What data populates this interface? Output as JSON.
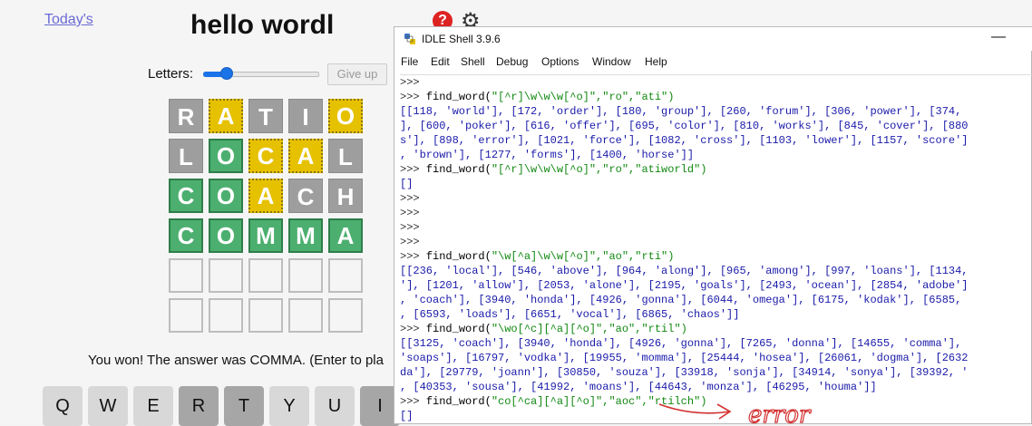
{
  "wordle": {
    "todays_link": "Today's",
    "title": "hello wordl",
    "help_icon_glyph": "?",
    "gear_icon_glyph": "⚙",
    "letters_label": "Letters:",
    "letters_slider_value": 0.17,
    "giveup_label": "Give up",
    "rows": [
      [
        {
          "letter": "R",
          "state": "absent"
        },
        {
          "letter": "A",
          "state": "present"
        },
        {
          "letter": "T",
          "state": "absent"
        },
        {
          "letter": "I",
          "state": "absent"
        },
        {
          "letter": "O",
          "state": "present"
        }
      ],
      [
        {
          "letter": "L",
          "state": "absent"
        },
        {
          "letter": "O",
          "state": "correct"
        },
        {
          "letter": "C",
          "state": "present"
        },
        {
          "letter": "A",
          "state": "present"
        },
        {
          "letter": "L",
          "state": "absent"
        }
      ],
      [
        {
          "letter": "C",
          "state": "correct"
        },
        {
          "letter": "O",
          "state": "correct"
        },
        {
          "letter": "A",
          "state": "present"
        },
        {
          "letter": "C",
          "state": "absent"
        },
        {
          "letter": "H",
          "state": "absent"
        }
      ],
      [
        {
          "letter": "C",
          "state": "correct"
        },
        {
          "letter": "O",
          "state": "correct"
        },
        {
          "letter": "M",
          "state": "correct"
        },
        {
          "letter": "M",
          "state": "correct"
        },
        {
          "letter": "A",
          "state": "correct"
        }
      ],
      [
        {
          "letter": "",
          "state": "empty"
        },
        {
          "letter": "",
          "state": "empty"
        },
        {
          "letter": "",
          "state": "empty"
        },
        {
          "letter": "",
          "state": "empty"
        },
        {
          "letter": "",
          "state": "empty"
        }
      ],
      [
        {
          "letter": "",
          "state": "empty"
        },
        {
          "letter": "",
          "state": "empty"
        },
        {
          "letter": "",
          "state": "empty"
        },
        {
          "letter": "",
          "state": "empty"
        },
        {
          "letter": "",
          "state": "empty"
        }
      ]
    ],
    "message": "You won! The answer was COMMA. (Enter to pla",
    "keys": [
      {
        "label": "Q",
        "state": "plain"
      },
      {
        "label": "W",
        "state": "plain"
      },
      {
        "label": "E",
        "state": "plain"
      },
      {
        "label": "R",
        "state": "absent"
      },
      {
        "label": "T",
        "state": "absent"
      },
      {
        "label": "Y",
        "state": "plain"
      },
      {
        "label": "U",
        "state": "plain"
      },
      {
        "label": "I",
        "state": "absent"
      }
    ]
  },
  "idle": {
    "window_title": "IDLE Shell 3.9.6",
    "minimize_glyph": "—",
    "menu": [
      "File",
      "Edit",
      "Shell",
      "Debug",
      "Options",
      "Window",
      "Help"
    ],
    "lines": [
      {
        "kind": "prompt",
        "prompt": ">>>",
        "cmd": "",
        "args": ""
      },
      {
        "kind": "input",
        "prompt": ">>>",
        "cmd": "find_word(",
        "args": "\"[^r]\\w\\w\\w[^o]\",\"ro\",\"ati\")"
      },
      {
        "kind": "output",
        "text": "[[118, 'world'], [172, 'order'], [180, 'group'], [260, 'forum'], [306, 'power'], [374,"
      },
      {
        "kind": "output",
        "text": "], [600, 'poker'], [616, 'offer'], [695, 'color'], [810, 'works'], [845, 'cover'], [880"
      },
      {
        "kind": "output",
        "text": "s'], [898, 'error'], [1021, 'force'], [1082, 'cross'], [1103, 'lower'], [1157, 'score']"
      },
      {
        "kind": "output",
        "text": ", 'brown'], [1277, 'forms'], [1400, 'horse']]"
      },
      {
        "kind": "input",
        "prompt": ">>>",
        "cmd": "find_word(",
        "args": "\"[^r]\\w\\w\\w[^o]\",\"ro\",\"atiworld\")"
      },
      {
        "kind": "output",
        "text": "[]"
      },
      {
        "kind": "prompt",
        "prompt": ">>>",
        "cmd": "",
        "args": ""
      },
      {
        "kind": "prompt",
        "prompt": ">>>",
        "cmd": "",
        "args": ""
      },
      {
        "kind": "prompt",
        "prompt": ">>>",
        "cmd": "",
        "args": ""
      },
      {
        "kind": "prompt",
        "prompt": ">>>",
        "cmd": "",
        "args": ""
      },
      {
        "kind": "input",
        "prompt": ">>>",
        "cmd": "find_word(",
        "args": "\"\\w[^a]\\w\\w[^o]\",\"ao\",\"rti\")"
      },
      {
        "kind": "output",
        "text": "[[236, 'local'], [546, 'above'], [964, 'along'], [965, 'among'], [997, 'loans'], [1134,"
      },
      {
        "kind": "output",
        "text": "'], [1201, 'allow'], [2053, 'alone'], [2195, 'goals'], [2493, 'ocean'], [2854, 'adobe']"
      },
      {
        "kind": "output",
        "text": ", 'coach'], [3940, 'honda'], [4926, 'gonna'], [6044, 'omega'], [6175, 'kodak'], [6585,"
      },
      {
        "kind": "output",
        "text": ", [6593, 'loads'], [6651, 'vocal'], [6865, 'chaos']]"
      },
      {
        "kind": "input",
        "prompt": ">>>",
        "cmd": "find_word(",
        "args": "\"\\wo[^c][^a][^o]\",\"ao\",\"rtil\")"
      },
      {
        "kind": "output",
        "text": "[[3125, 'coach'], [3940, 'honda'], [4926, 'gonna'], [7265, 'donna'], [14655, 'comma'],"
      },
      {
        "kind": "output",
        "text": "'soaps'], [16797, 'vodka'], [19955, 'momma'], [25444, 'hosea'], [26061, 'dogma'], [2632"
      },
      {
        "kind": "output",
        "text": "da'], [29779, 'joann'], [30850, 'souza'], [33918, 'sonja'], [34914, 'sonya'], [39392, '"
      },
      {
        "kind": "output",
        "text": ", [40353, 'sousa'], [41992, 'moans'], [44643, 'monza'], [46295, 'houma']]"
      },
      {
        "kind": "input",
        "prompt": ">>>",
        "cmd": "find_word(",
        "args": "\"co[^ca][^a][^o]\",\"aoc\",\"rtilch\")"
      },
      {
        "kind": "output",
        "text": "[]"
      }
    ],
    "scribble_text": "error",
    "scribble_color": "#d23030"
  }
}
